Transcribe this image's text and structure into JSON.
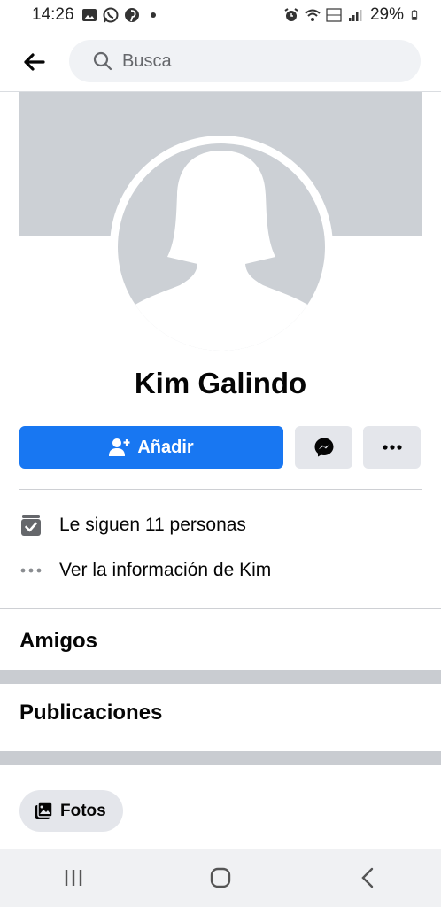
{
  "status_bar": {
    "time": "14:26",
    "battery": "29%",
    "notification_icons": [
      "gallery-icon",
      "whatsapp-icon",
      "pinterest-icon",
      "dot-icon"
    ],
    "system_icons": [
      "alarm-icon",
      "wifi-icon",
      "volte-icon",
      "signal-icon",
      "battery-icon"
    ]
  },
  "header": {
    "search_placeholder": "Busca"
  },
  "profile": {
    "name": "Kim Galindo",
    "add_label": "Añadir"
  },
  "info": {
    "followers": "Le siguen 11 personas",
    "see_info": "Ver la información de Kim"
  },
  "sections": {
    "friends": "Amigos",
    "posts": "Publicaciones"
  },
  "photos_chip": "Fotos",
  "colors": {
    "accent": "#1877f2",
    "placeholder_gray": "#ccd0d5",
    "button_gray": "#e4e6eb"
  }
}
